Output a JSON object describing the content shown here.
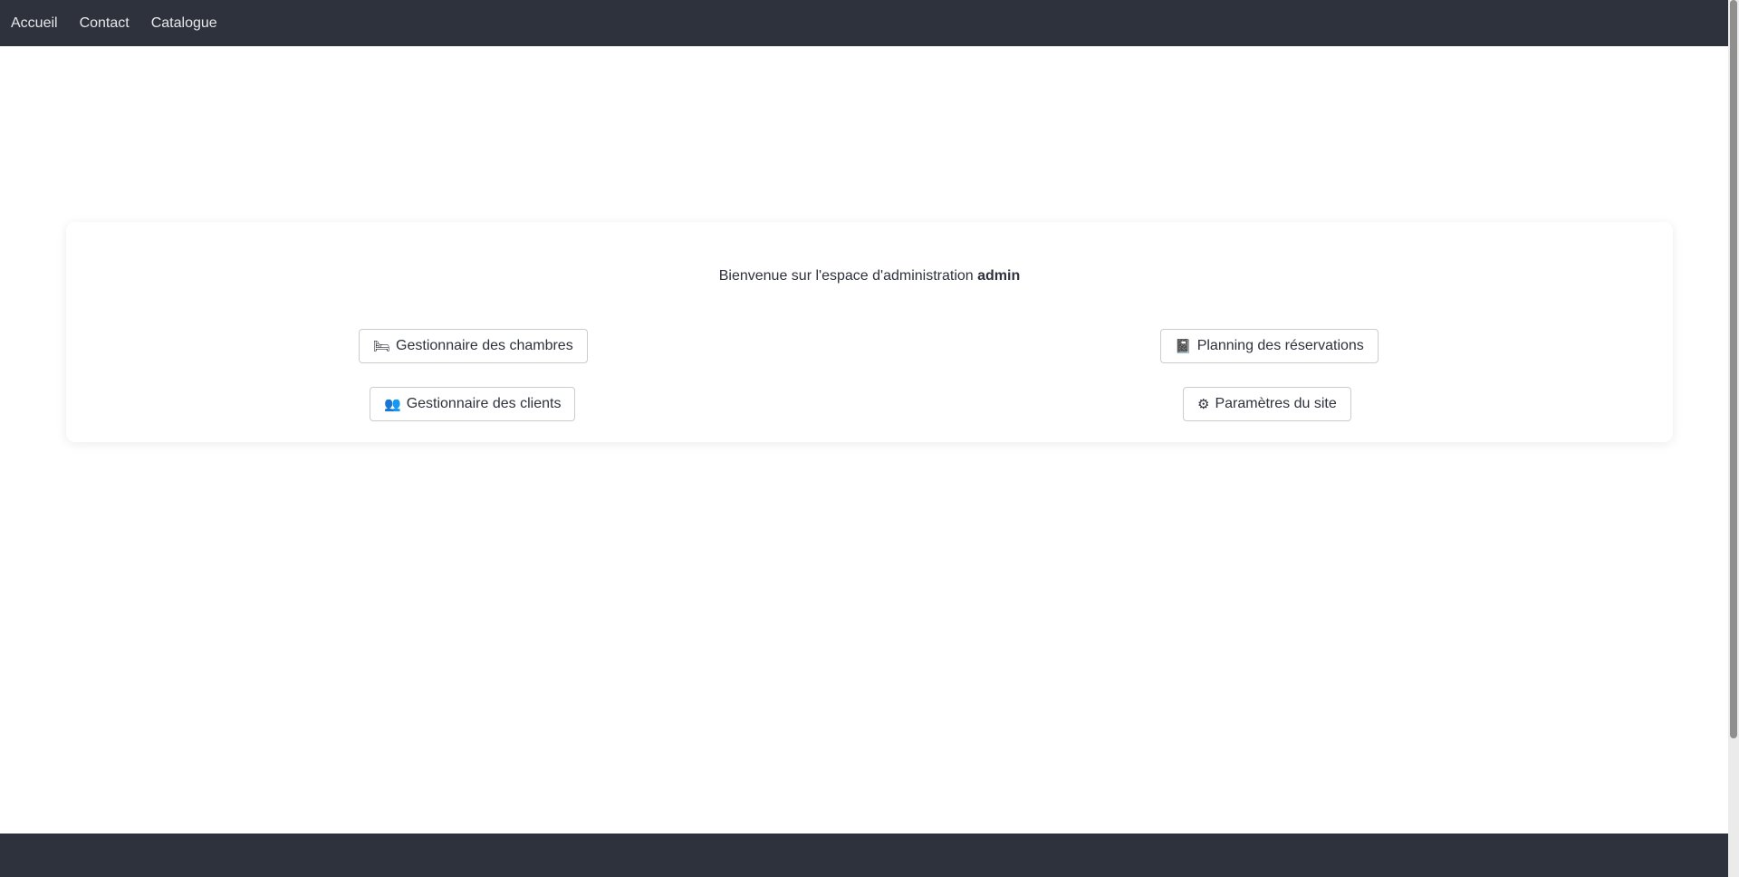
{
  "nav": {
    "items": [
      {
        "label": "Accueil"
      },
      {
        "label": "Contact"
      },
      {
        "label": "Catalogue"
      }
    ]
  },
  "admin": {
    "welcome_text": "Bienvenue sur l'espace d'administration ",
    "username": "admin",
    "buttons": {
      "rooms": {
        "icon": "🛏",
        "label": "Gestionnaire des chambres",
        "icon_name": "bed-icon"
      },
      "planning": {
        "icon": "📓",
        "label": "Planning des réservations",
        "icon_name": "calendar-icon"
      },
      "clients": {
        "icon": "👥",
        "label": "Gestionnaire des clients",
        "icon_name": "users-icon"
      },
      "settings": {
        "icon": "⚙",
        "label": "Paramètres du site",
        "icon_name": "gear-icon"
      }
    }
  },
  "colors": {
    "navbar": "#2e323c",
    "footer": "#2e323c",
    "text": "#2e323c"
  }
}
